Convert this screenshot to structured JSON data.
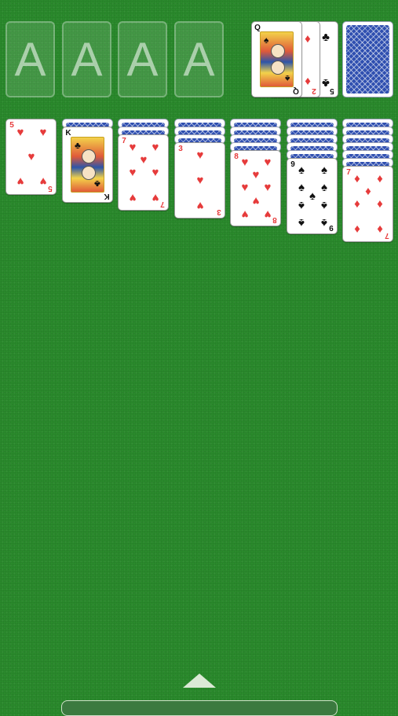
{
  "foundations": [
    {
      "label": "A"
    },
    {
      "label": "A"
    },
    {
      "label": "A"
    },
    {
      "label": "A"
    }
  ],
  "waste": [
    {
      "rank": "Q",
      "suit": "♠",
      "color": "black"
    },
    {
      "rank": "2",
      "suit": "♦",
      "color": "red"
    },
    {
      "rank": "5",
      "suit": "♣",
      "color": "black"
    }
  ],
  "stock": {
    "face_down": true
  },
  "tableau": [
    {
      "hidden": 0,
      "top": {
        "rank": "5",
        "suit": "♥",
        "color": "red"
      }
    },
    {
      "hidden": 1,
      "top": {
        "rank": "K",
        "suit": "♣",
        "color": "black"
      }
    },
    {
      "hidden": 2,
      "top": {
        "rank": "7",
        "suit": "♥",
        "color": "red"
      }
    },
    {
      "hidden": 3,
      "top": {
        "rank": "3",
        "suit": "♥",
        "color": "red"
      }
    },
    {
      "hidden": 4,
      "top": {
        "rank": "8",
        "suit": "♥",
        "color": "red"
      }
    },
    {
      "hidden": 5,
      "top": {
        "rank": "9",
        "suit": "♠",
        "color": "black"
      }
    },
    {
      "hidden": 6,
      "top": {
        "rank": "7",
        "suit": "♦",
        "color": "red"
      }
    }
  ],
  "colors": {
    "felt": "#2a8a2c",
    "red_suit": "#e63b3b",
    "black_suit": "#111111",
    "card_back": "#2f4fb0"
  },
  "icons": {
    "menu_toggle": "up-triangle-icon"
  }
}
